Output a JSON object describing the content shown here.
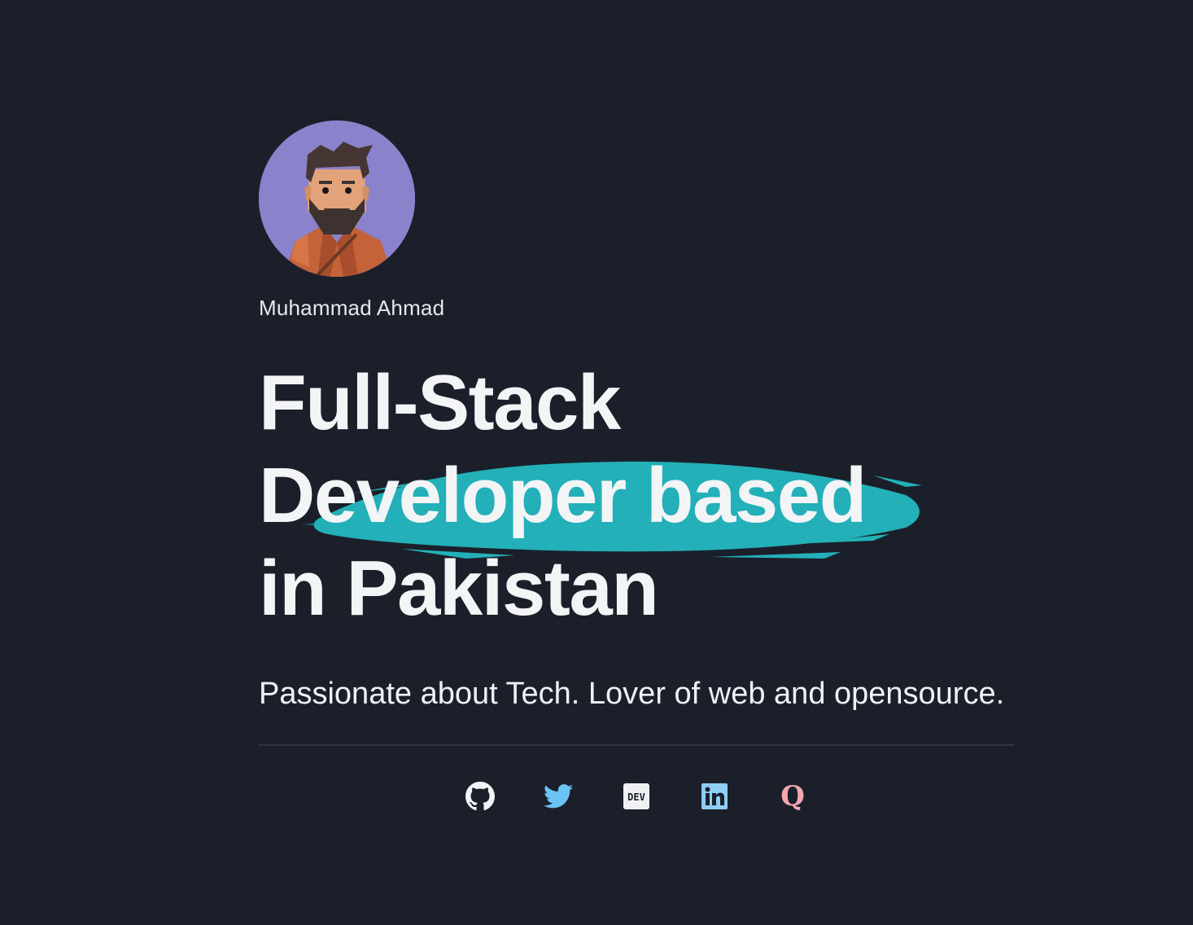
{
  "profile": {
    "name": "Muhammad Ahmad"
  },
  "headline": {
    "line1": "Full-Stack",
    "line2": "Developer based",
    "line3": "in Pakistan"
  },
  "tagline": "Passionate about Tech. Lover of web and opensource.",
  "socials": [
    {
      "icon": "github-icon",
      "color": "#f3f4f6"
    },
    {
      "icon": "twitter-icon",
      "color": "#6cc4f5"
    },
    {
      "icon": "dev-icon",
      "color": "#eef0f3",
      "text": "DEV"
    },
    {
      "icon": "linkedin-icon",
      "color": "#8fcdf5"
    },
    {
      "icon": "quora-icon",
      "color": "#f4a7b1",
      "text": "Q"
    }
  ],
  "colors": {
    "background": "#1b1f2a",
    "accent_brush": "#23b0b8",
    "avatar_bg": "#8b82cc"
  }
}
